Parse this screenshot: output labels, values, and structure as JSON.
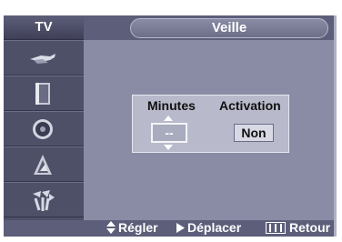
{
  "osd": {
    "tab_label": "TV",
    "title": "Veille",
    "sidebar": {
      "items": [
        {
          "icon": "antenna-icon"
        },
        {
          "icon": "picture-icon"
        },
        {
          "icon": "speaker-icon"
        },
        {
          "icon": "channel-icon"
        },
        {
          "icon": "setup-icon"
        }
      ]
    },
    "settings": {
      "minutes_label": "Minutes",
      "minutes_value": "--",
      "activation_label": "Activation",
      "activation_value": "Non"
    },
    "footer": {
      "adjust_label": "Régler",
      "move_label": "Déplacer",
      "return_label": "Retour"
    }
  }
}
